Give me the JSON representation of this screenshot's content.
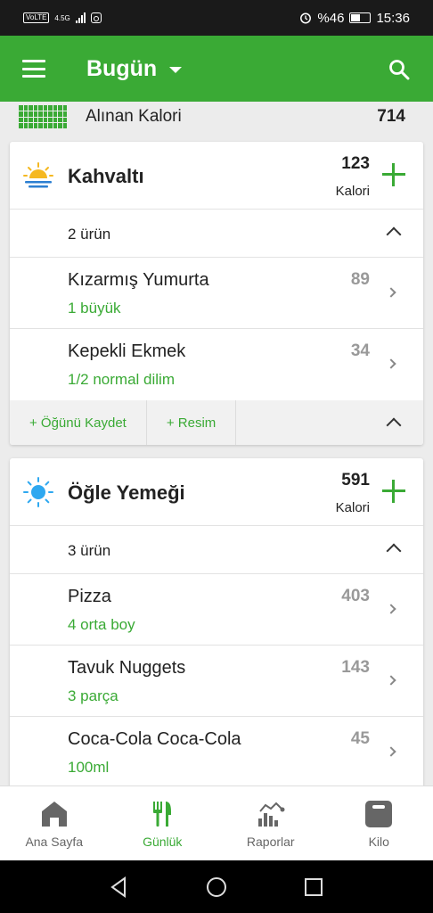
{
  "status_bar": {
    "volte": "VoLTE",
    "network": "4.5G",
    "battery": "%46",
    "time": "15:36"
  },
  "app_bar": {
    "title": "Bugün"
  },
  "summary": {
    "label": "Alınan Kalori",
    "value": "714"
  },
  "colors": {
    "brand_green": "#3aaa35",
    "calorie_grey": "#999999"
  },
  "meals": [
    {
      "title": "Kahvaltı",
      "icon": "sunrise-icon",
      "kcal": "123",
      "kcal_unit": "Kalori",
      "count_label": "2 ürün",
      "items": [
        {
          "name": "Kızarmış Yumurta",
          "portion": "1 büyük",
          "kcal": "89"
        },
        {
          "name": "Kepekli Ekmek",
          "portion": "1/2 normal dilim",
          "kcal": "34"
        }
      ],
      "actions": [
        "+ Öğünü Kaydet",
        "+ Resim"
      ]
    },
    {
      "title": "Öğle Yemeği",
      "icon": "sun-icon",
      "kcal": "591",
      "kcal_unit": "Kalori",
      "count_label": "3 ürün",
      "items": [
        {
          "name": "Pizza",
          "portion": "4  orta boy",
          "kcal": "403"
        },
        {
          "name": "Tavuk Nuggets",
          "portion": "3  parça",
          "kcal": "143"
        },
        {
          "name": "Coca-Cola Coca-Cola",
          "portion": "100ml",
          "kcal": "45"
        }
      ]
    }
  ],
  "bottom_nav": [
    {
      "label": "Ana Sayfa",
      "icon": "home-icon",
      "active": false
    },
    {
      "label": "Günlük",
      "icon": "fork-knife-icon",
      "active": true
    },
    {
      "label": "Raporlar",
      "icon": "chart-icon",
      "active": false
    },
    {
      "label": "Kilo",
      "icon": "scale-icon",
      "active": false
    }
  ]
}
